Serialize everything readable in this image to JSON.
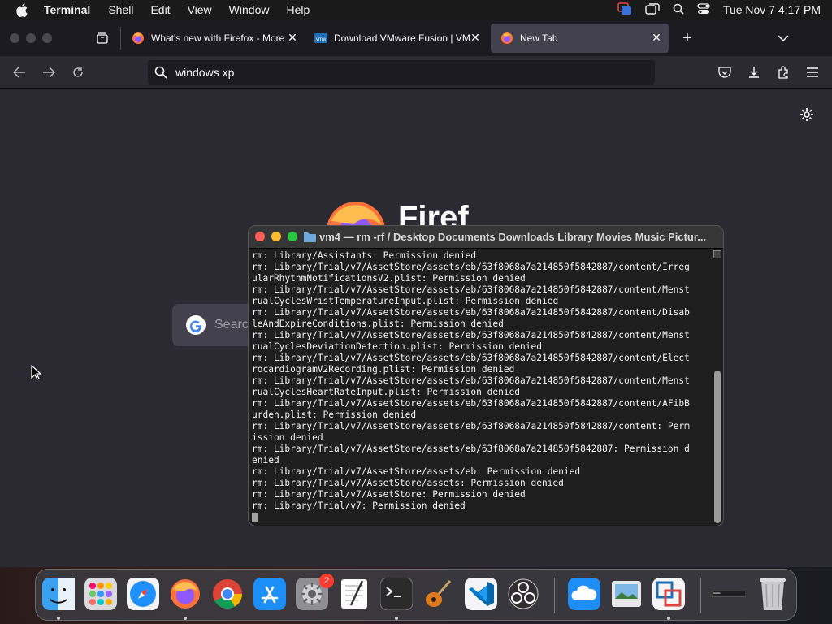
{
  "menubar": {
    "apple_icon": "apple-icon",
    "app_name": "Terminal",
    "items": [
      "Shell",
      "Edit",
      "View",
      "Window",
      "Help"
    ],
    "clock": "Tue Nov 7  4:17 PM"
  },
  "browser": {
    "tabs": [
      {
        "title": "What's new with Firefox - More",
        "icon": "firefox-icon"
      },
      {
        "title": "Download VMware Fusion | VMw",
        "icon": "vmware-icon"
      },
      {
        "title": "New Tab",
        "icon": "firefox-icon"
      }
    ],
    "url_value": "windows xp",
    "newtab_search_placeholder": "Searc",
    "brand_word": "Firef"
  },
  "terminal": {
    "title": "vm4 — rm -rf / Desktop Documents Downloads Library Movies Music Pictur...",
    "lines": [
      "rm: Library/Assistants: Permission denied",
      "rm: Library/Trial/v7/AssetStore/assets/eb/63f8068a7a214850f5842887/content/Irreg",
      "ularRhythmNotificationsV2.plist: Permission denied",
      "rm: Library/Trial/v7/AssetStore/assets/eb/63f8068a7a214850f5842887/content/Menst",
      "rualCyclesWristTemperatureInput.plist: Permission denied",
      "rm: Library/Trial/v7/AssetStore/assets/eb/63f8068a7a214850f5842887/content/Disab",
      "leAndExpireConditions.plist: Permission denied",
      "rm: Library/Trial/v7/AssetStore/assets/eb/63f8068a7a214850f5842887/content/Menst",
      "rualCyclesDeviationDetection.plist: Permission denied",
      "rm: Library/Trial/v7/AssetStore/assets/eb/63f8068a7a214850f5842887/content/Elect",
      "rocardiogramV2Recording.plist: Permission denied",
      "rm: Library/Trial/v7/AssetStore/assets/eb/63f8068a7a214850f5842887/content/Menst",
      "rualCyclesHeartRateInput.plist: Permission denied",
      "rm: Library/Trial/v7/AssetStore/assets/eb/63f8068a7a214850f5842887/content/AFibB",
      "urden.plist: Permission denied",
      "rm: Library/Trial/v7/AssetStore/assets/eb/63f8068a7a214850f5842887/content: Perm",
      "ission denied",
      "rm: Library/Trial/v7/AssetStore/assets/eb/63f8068a7a214850f5842887: Permission d",
      "enied",
      "rm: Library/Trial/v7/AssetStore/assets/eb: Permission denied",
      "rm: Library/Trial/v7/AssetStore/assets: Permission denied",
      "rm: Library/Trial/v7/AssetStore: Permission denied",
      "rm: Library/Trial/v7: Permission denied"
    ]
  },
  "dock": {
    "items": [
      {
        "name": "finder",
        "icon": "finder-icon",
        "running": true
      },
      {
        "name": "launchpad",
        "icon": "launchpad-icon",
        "running": false
      },
      {
        "name": "safari",
        "icon": "safari-icon",
        "running": false
      },
      {
        "name": "firefox",
        "icon": "firefox-icon",
        "running": true
      },
      {
        "name": "chrome",
        "icon": "chrome-icon",
        "running": false
      },
      {
        "name": "app-store",
        "icon": "app-store-icon",
        "running": false
      },
      {
        "name": "system-settings",
        "icon": "gear-icon",
        "running": false,
        "badge": "2"
      },
      {
        "name": "textedit",
        "icon": "textedit-icon",
        "running": false
      },
      {
        "name": "terminal",
        "icon": "terminal-icon",
        "running": true
      },
      {
        "name": "garageband",
        "icon": "guitar-icon",
        "running": false
      },
      {
        "name": "vscode",
        "icon": "vscode-icon",
        "running": false
      },
      {
        "name": "obs",
        "icon": "obs-icon",
        "running": false
      },
      {
        "name": "icloud",
        "icon": "cloud-icon",
        "running": false
      },
      {
        "name": "preview",
        "icon": "preview-icon",
        "running": false
      },
      {
        "name": "vmware-fusion",
        "icon": "vmware-icon",
        "running": true
      },
      {
        "name": "minimized-window",
        "icon": "window-thumbnail-icon",
        "running": false
      },
      {
        "name": "trash",
        "icon": "trash-icon",
        "running": false
      }
    ]
  },
  "colors": {
    "firefox_orange": "#ff7139",
    "terminal_red": "#ff5f57",
    "terminal_yellow": "#febc2e",
    "terminal_green": "#28c840"
  }
}
